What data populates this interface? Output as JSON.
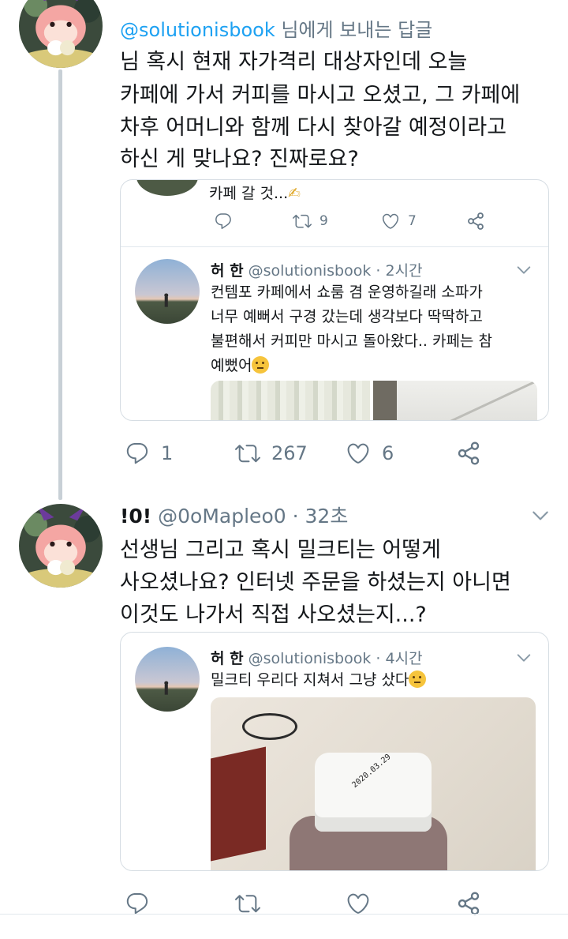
{
  "reply_to": {
    "handle": "@solutionisbook",
    "suffix": " 님에게 보내는 답글"
  },
  "tweet1": {
    "lines": [
      "님 혹시 현재 자가격리 대상자인데 오늘",
      "카페에 가서 커피를 마시고 오셨고, 그 카페에",
      "차후 어머니와 함께 다시 찾아갈 예정이라고",
      "하신 게 맞나요? 진짜로요?"
    ],
    "card": {
      "partial_text": "카페 갈 것...",
      "inner_actions": {
        "retweets": "9",
        "likes": "7"
      },
      "quoted": {
        "name": "허 한",
        "handle": "@solutionisbook",
        "time": "· 2시간",
        "lines": [
          "컨템포 카페에서 쇼룸 겸 운영하길래 소파가",
          "너무 예뻐서 구경 갔는데 생각보다 딱딱하고",
          "불편해서 커피만 마시고 돌아왔다.. 카페는 참",
          "예뻤어"
        ]
      }
    },
    "actions": {
      "replies": "1",
      "retweets": "267",
      "likes": "6"
    }
  },
  "tweet2": {
    "name": "!0!",
    "handle": "@0oMapleo0",
    "time": "· 32초",
    "lines": [
      "선생님 그리고 혹시 밀크티는 어떻게",
      "사오셨나요? 인터넷 주문을 하셨는지 아니면",
      "이것도 나가서 직접 사오셨는지...?"
    ],
    "card": {
      "quoted": {
        "name": "허 한",
        "handle": "@solutionisbook",
        "time": "· 4시간",
        "text": "밀크티 우리다 지쳐서 그냥 샀다"
      },
      "photo_cap_print": "2020.03.29"
    }
  },
  "colors": {
    "accent": "#1da1f2",
    "secondary_text": "#657786",
    "border": "#d6dde3",
    "thread_line": "#c8d0d6"
  },
  "icons": [
    "reply-icon",
    "retweet-icon",
    "like-icon",
    "share-icon",
    "chevron-down-icon"
  ]
}
